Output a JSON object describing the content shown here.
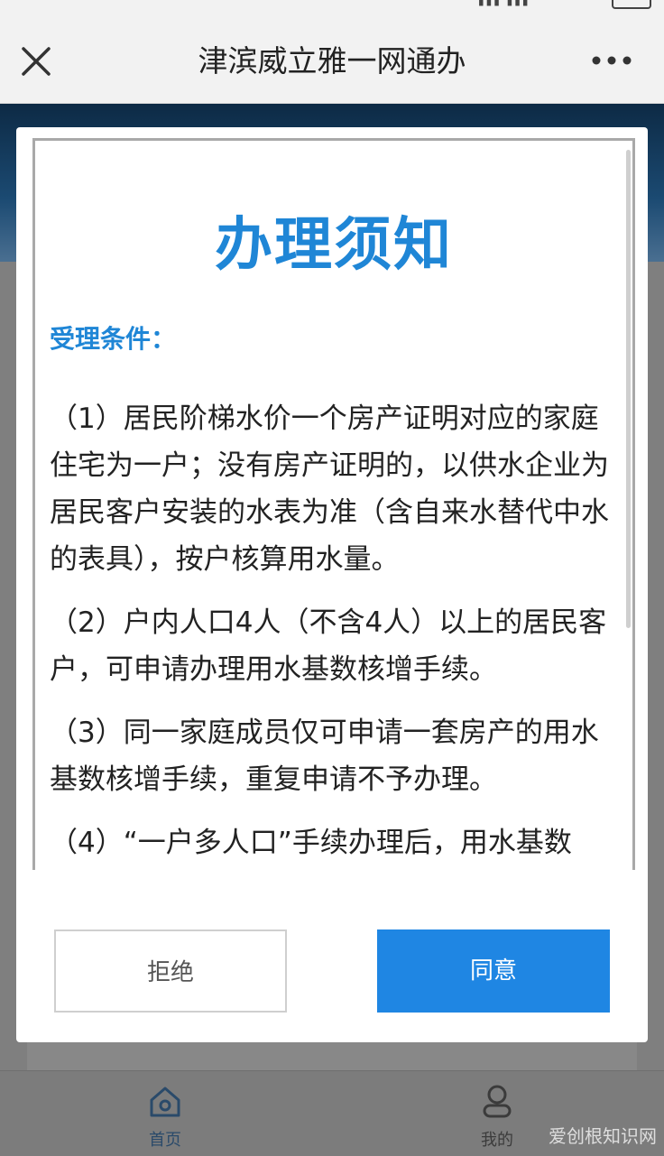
{
  "header": {
    "title": "津滨威立雅一网通办"
  },
  "notice": {
    "title": "办理须知",
    "section_title": "受理条件：",
    "paragraphs": [
      "（1）居民阶梯水价一个房产证明对应的家庭住宅为一户；没有房产证明的，以供水企业为居民客户安装的水表为准（含自来水替代中水的表具），按户核算用水量。",
      "（2）户内人口4人（不含4人）以上的居民客户，可申请办理用水基数核增手续。",
      "（3）同一家庭成员仅可申请一套房产的用水基数核增手续，重复申请不予办理。",
      "（4）“一户多人口”手续办理后，用水基数"
    ]
  },
  "buttons": {
    "reject": "拒绝",
    "agree": "同意"
  },
  "bottom_nav": [
    {
      "label": "首页",
      "icon": "home-icon"
    },
    {
      "label": "我的",
      "icon": "user-icon"
    }
  ],
  "watermark": "爱创根知识网",
  "colors": {
    "accent": "#1f86e3",
    "title": "#1f86d6"
  }
}
